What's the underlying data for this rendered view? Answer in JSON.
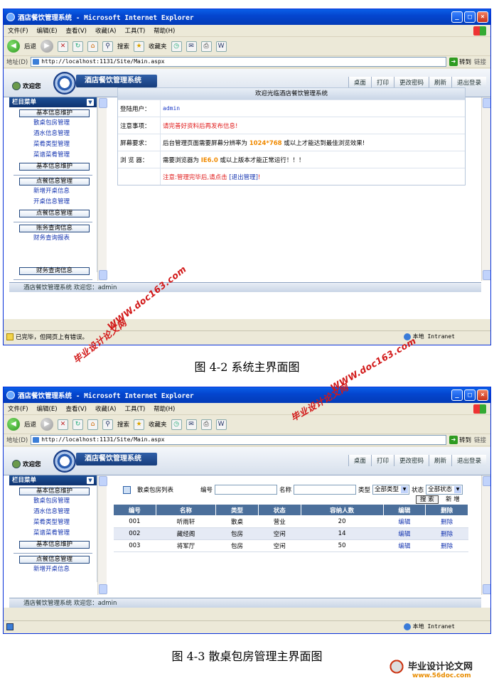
{
  "browser": {
    "window_title": "酒店餐饮管理系统 - Microsoft Internet Explorer",
    "menu": [
      "文件(F)",
      "编辑(E)",
      "查看(V)",
      "收藏(A)",
      "工具(T)",
      "帮助(H)"
    ],
    "toolbar": {
      "back": "后退",
      "search": "搜索",
      "favorites": "收藏夹"
    },
    "address_label": "地址(D)",
    "url": "http://localhost:1131/Site/Main.aspx",
    "go_label": "转到",
    "links_label": "链接"
  },
  "app": {
    "welcome": "欢迎您",
    "title": "酒店餐饮管理系统",
    "header_buttons": [
      "桌面",
      "打印",
      "更改密码",
      "刷新",
      "退出登录"
    ],
    "sidebar_title": "栏目菜单",
    "footer_text": "酒店餐饮管理系统 欢迎您：admin"
  },
  "shot1": {
    "sidebar": [
      {
        "type": "section",
        "label": "基本信息维护"
      },
      {
        "type": "link",
        "label": "散桌包房管理"
      },
      {
        "type": "link",
        "label": "酒水信息管理"
      },
      {
        "type": "link",
        "label": "菜肴类型管理"
      },
      {
        "type": "link",
        "label": "菜谱菜肴管理"
      },
      {
        "type": "section",
        "label": "基本信息维护"
      },
      {
        "type": "sep"
      },
      {
        "type": "section",
        "label": "点餐信息管理"
      },
      {
        "type": "link",
        "label": "新增开桌信息"
      },
      {
        "type": "link",
        "label": "开桌信息管理"
      },
      {
        "type": "section",
        "label": "点餐信息管理"
      },
      {
        "type": "sep"
      },
      {
        "type": "section",
        "label": "账务查询信息"
      },
      {
        "type": "link",
        "label": "财务查询报表"
      },
      {
        "type": "gap"
      },
      {
        "type": "section",
        "label": "财务查询信息"
      },
      {
        "type": "sep"
      }
    ],
    "welcome_box": {
      "title": "欢迎光临酒店餐饮管理系统",
      "login_label": "登陆用户：",
      "login_value": "admin",
      "notice_label": "注意事项：",
      "notice_value": "请完善好资料后再发布信息!",
      "screen_label": "屏幕要求：",
      "screen_before": "后台管理页面需要屏幕分辨率为 ",
      "screen_res": "1024*768",
      "screen_after": " 或以上才能达到最佳浏览效果!",
      "browser_label": "浏 览 器：",
      "browser_before": "需要浏览器为 ",
      "browser_ver": "IE6.0",
      "browser_after": " 或以上版本才能正常运行！！！",
      "exit_note_before": "注意:管理完毕后,请点击 ",
      "exit_note_link": "[退出管理]",
      "exit_note_after": "!"
    },
    "status_text": "已完毕，但网页上有错误。",
    "zone_text": "本地 Intranet"
  },
  "shot2": {
    "sidebar": [
      {
        "type": "section",
        "label": "基本信息维护"
      },
      {
        "type": "link",
        "label": "散桌包房管理"
      },
      {
        "type": "link",
        "label": "酒水信息管理"
      },
      {
        "type": "link",
        "label": "菜肴类型管理"
      },
      {
        "type": "link",
        "label": "菜谱菜肴管理"
      },
      {
        "type": "section",
        "label": "基本信息维护"
      },
      {
        "type": "sep"
      },
      {
        "type": "section",
        "label": "点餐信息管理"
      },
      {
        "type": "link",
        "label": "新增开桌信息"
      }
    ],
    "list": {
      "title": "散桌包房列表",
      "number_label": "编号",
      "name_label": "名称",
      "type_label": "类型",
      "type_value": "全部类型",
      "status_label": "状态",
      "status_value": "全部状态",
      "search_button": "搜 索",
      "add_button": "新 增",
      "columns": [
        "编号",
        "名称",
        "类型",
        "状态",
        "容纳人数",
        "编辑",
        "删除"
      ],
      "rows": [
        [
          "001",
          "听雨轩",
          "散桌",
          "营业",
          "20",
          "编辑",
          "删除"
        ],
        [
          "002",
          "藏经阁",
          "包房",
          "空闲",
          "14",
          "编辑",
          "删除"
        ],
        [
          "003",
          "将军厅",
          "包房",
          "空闲",
          "50",
          "编辑",
          "删除"
        ]
      ]
    },
    "zone_text": "本地 Intranet"
  },
  "captions": {
    "fig1": "图 4-2  系统主界面图",
    "fig2": "图 4-3  散桌包房管理主界面图"
  },
  "watermarks": {
    "site": "WWW.doc163.com",
    "name": "毕业设计论文网",
    "brand_main": "毕业设计论文网",
    "brand_sub": "www.56doc.com"
  }
}
